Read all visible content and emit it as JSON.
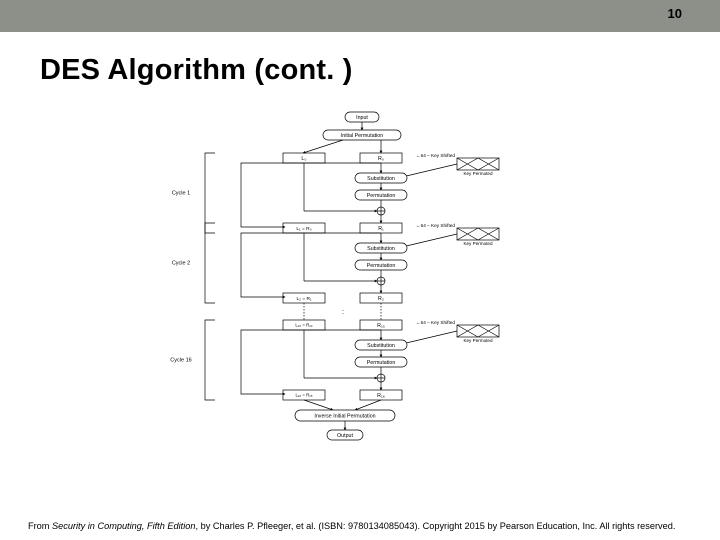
{
  "header": {
    "page_number": "10"
  },
  "title": "DES Algorithm (cont. )",
  "diagram": {
    "top": {
      "input": "Input",
      "ip": "Initial Permutation"
    },
    "cycle1": {
      "label": "Cycle 1",
      "L": "L₀",
      "R": "R₀",
      "keyshift_arrow": "64 – Key Shifted",
      "keyperm": "Key Permuted",
      "sub": "Substitution",
      "perm": "Permutation",
      "L_out": "L₁ = R₀",
      "R_out": "R₁"
    },
    "cycle2": {
      "label": "Cycle 2",
      "keyshift_arrow": "64 – Key Shifted",
      "keyperm": "Key Permuted",
      "sub": "Substitution",
      "perm": "Permutation",
      "L_out": "L₂ = R₁",
      "R_out": "R₂",
      "dots": ":",
      "mid_L": "L₁₅ = R₁₄",
      "mid_R": "R₁₅"
    },
    "cycle16": {
      "label": "Cycle 16",
      "keyshift_arrow": "64 – Key Shifted",
      "keyperm": "Key Permuted",
      "sub": "Substitution",
      "perm": "Permutation",
      "L_out": "L₁₆ = R₁₅",
      "R_out": "R₁₆"
    },
    "bottom": {
      "iip": "Inverse Initial Permutation",
      "output": "Output"
    }
  },
  "footer": {
    "prefix": "From ",
    "book": "Security in Computing, Fifth Edition",
    "rest": ", by Charles P. Pfleeger, et al. (ISBN: 9780134085043). Copyright 2015 by Pearson Education, Inc. All rights reserved."
  }
}
